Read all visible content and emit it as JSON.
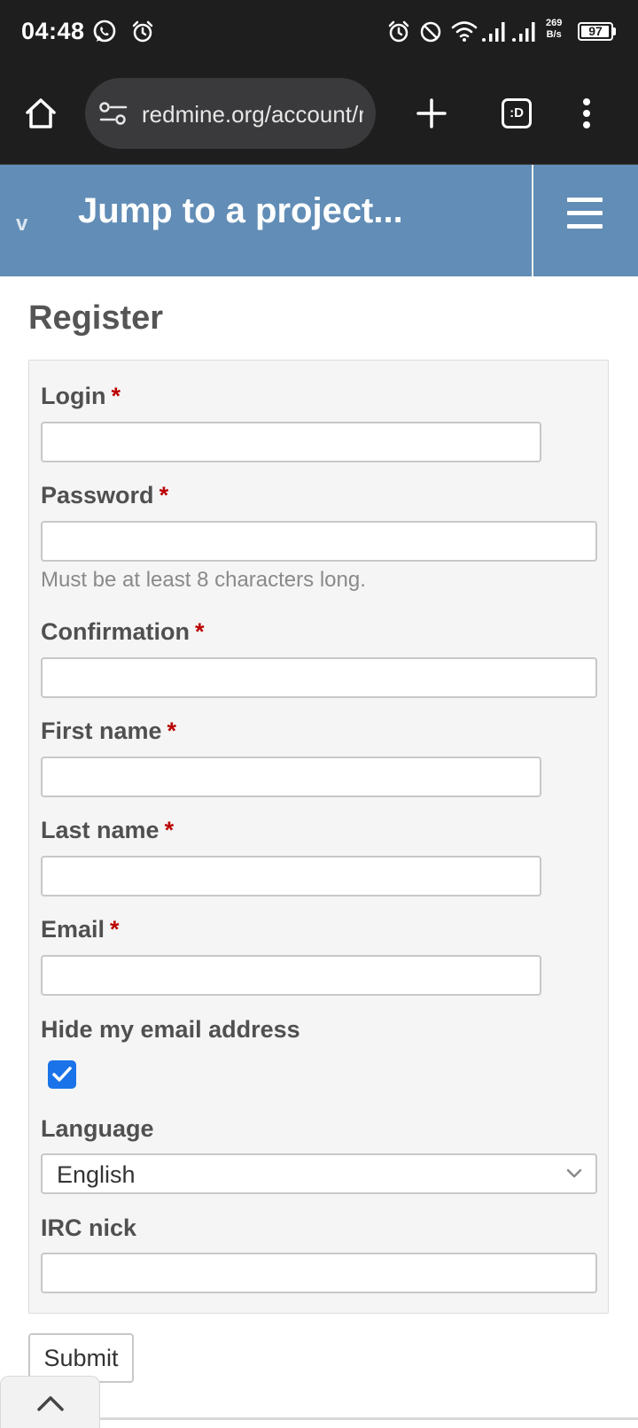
{
  "status_bar": {
    "time": "04:48",
    "net_speed_value": "269",
    "net_speed_unit": "B/s",
    "battery": "97",
    "icons": [
      "whatsapp-icon",
      "alarm-icon",
      "alarm-icon",
      "do-not-disturb-icon",
      "wifi-icon",
      "signal-icon",
      "signal-icon"
    ]
  },
  "browser": {
    "url": "redmine.org/account/register",
    "tabs_label": ":D",
    "icons": [
      "home-icon",
      "site-settings-icon",
      "new-tab-plus-icon",
      "tab-switcher-icon",
      "overflow-menu-icon"
    ]
  },
  "header": {
    "chevron": "v",
    "jump_label": "Jump to a project...",
    "bg_color": "#628db6"
  },
  "form": {
    "title": "Register",
    "required_marker": "*",
    "fields": {
      "login": {
        "label": "Login",
        "value": ""
      },
      "password": {
        "label": "Password",
        "value": "",
        "hint": "Must be at least 8 characters long."
      },
      "confirmation": {
        "label": "Confirmation",
        "value": ""
      },
      "firstname": {
        "label": "First name",
        "value": ""
      },
      "lastname": {
        "label": "Last name",
        "value": ""
      },
      "email": {
        "label": "Email",
        "value": ""
      },
      "hide_email": {
        "label": "Hide my email address",
        "checked": true
      },
      "language": {
        "label": "Language",
        "value": "English"
      },
      "irc": {
        "label": "IRC nick",
        "value": ""
      }
    },
    "submit_label": "Submit"
  },
  "colors": {
    "required": "#bb0000",
    "checkbox": "#1a73e8"
  }
}
